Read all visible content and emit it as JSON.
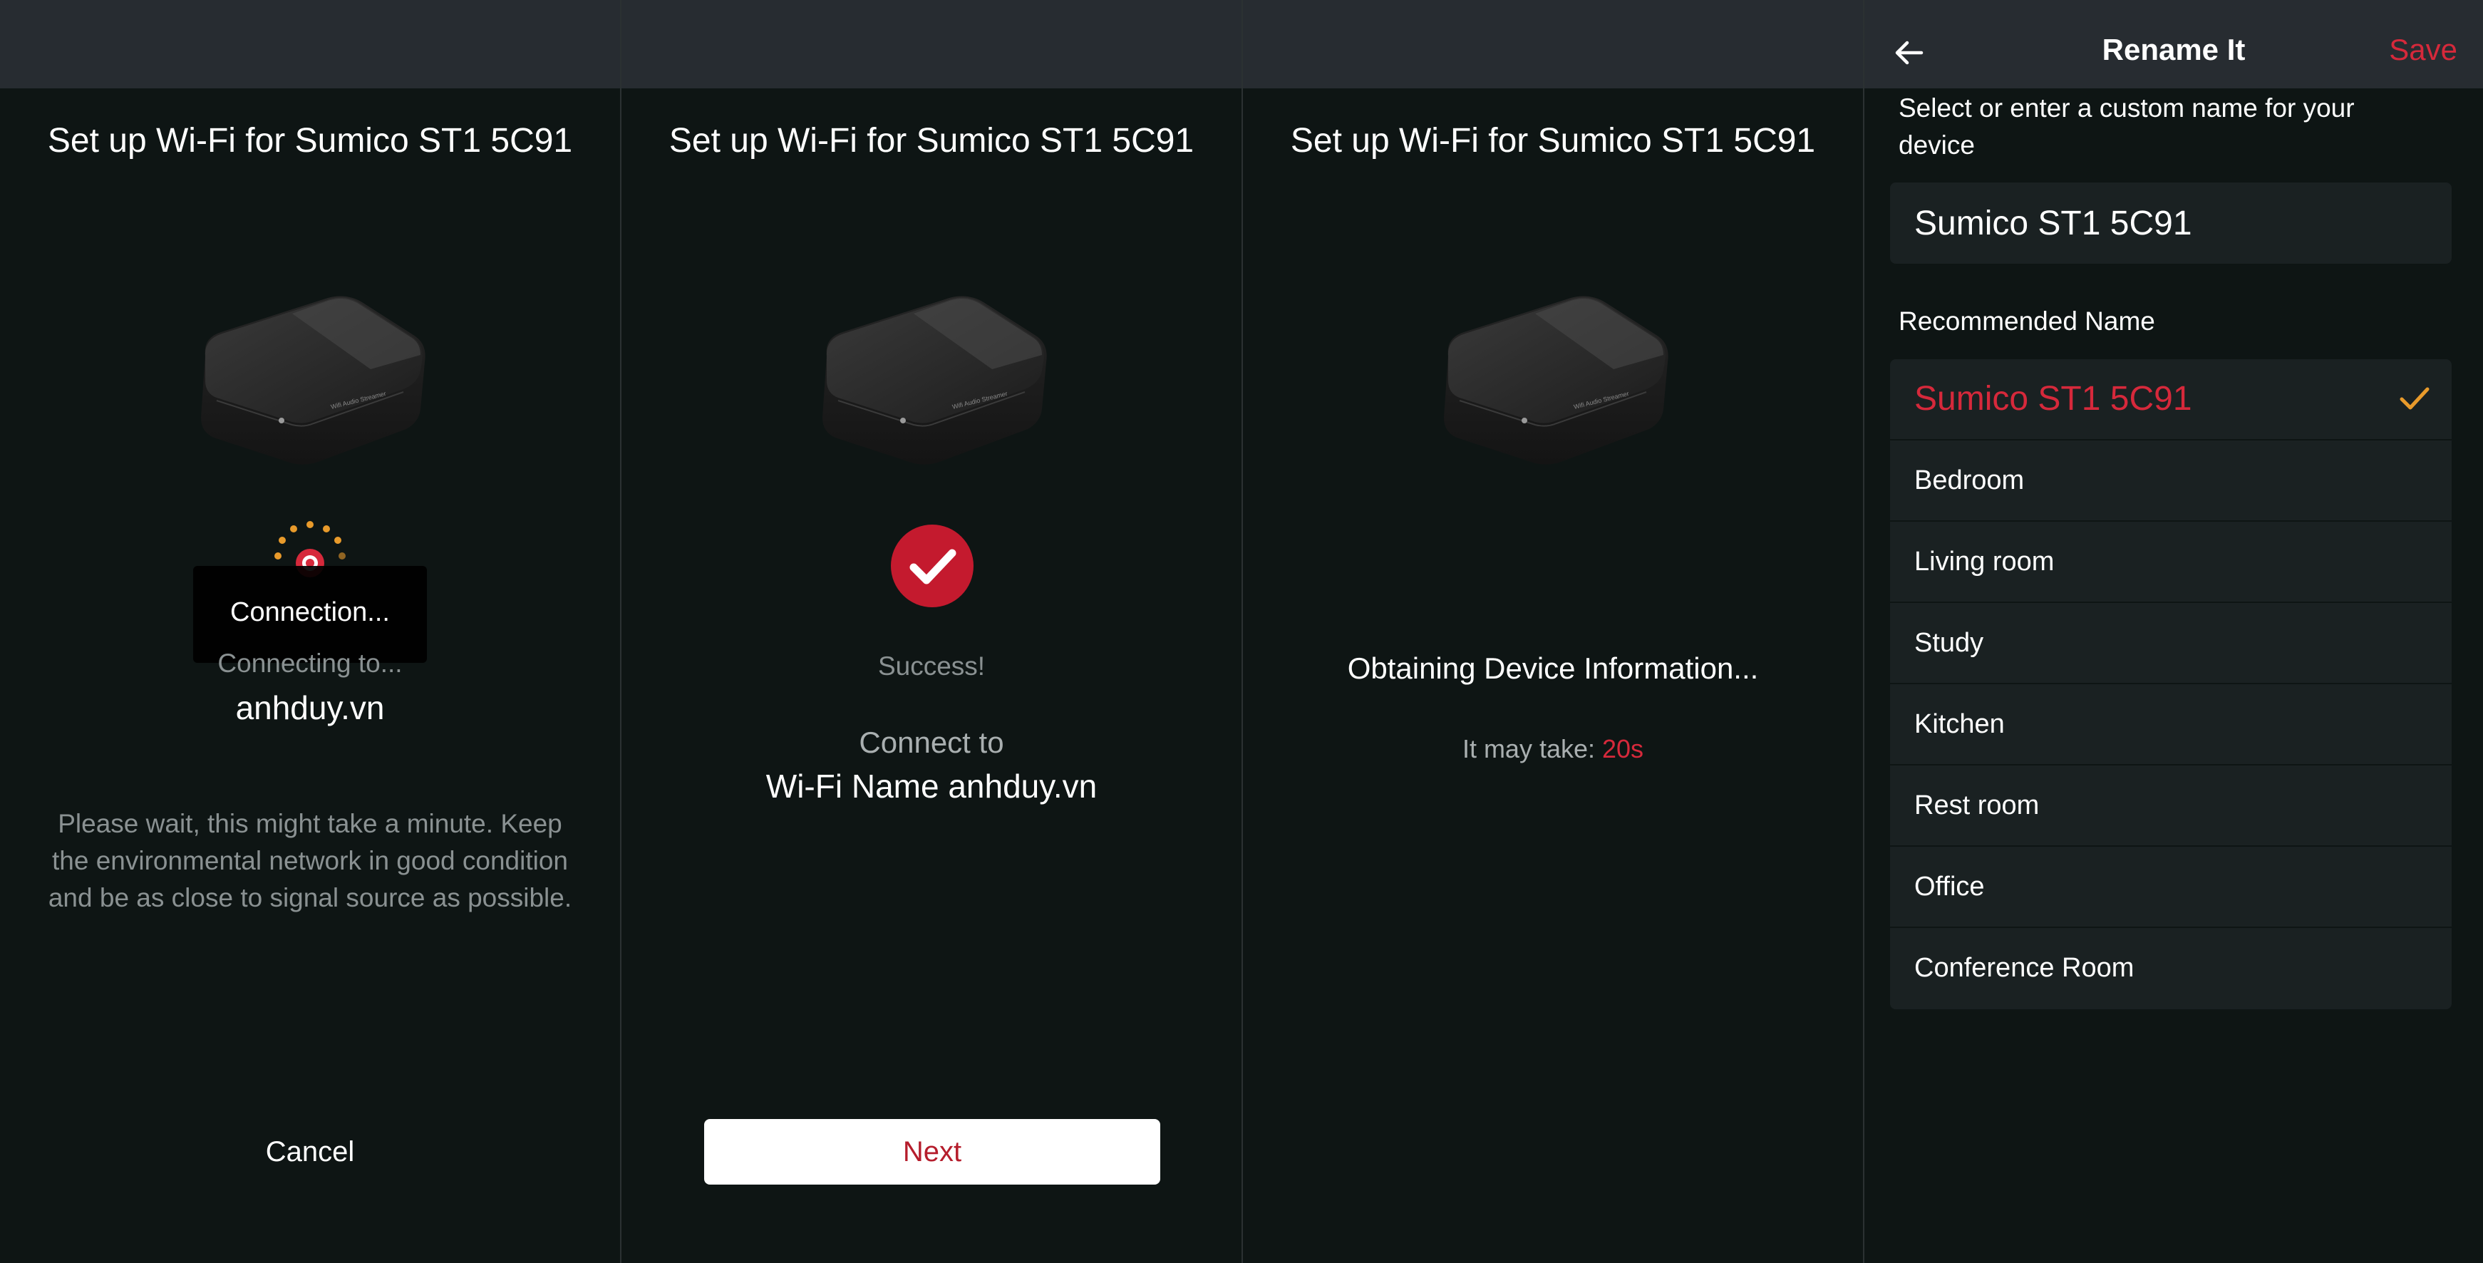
{
  "colors": {
    "accent_red": "#d6293b",
    "check_orange": "#e89a2b",
    "background": "#0e1514",
    "statusbar": "#272c31",
    "row_background": "#1a2122"
  },
  "screen_1": {
    "title": "Set up Wi-Fi for Sumico ST1 5C91",
    "device_image": "wifi-audio-streamer",
    "spinner_icon": "loading-spinner-icon",
    "toast": "Connection...",
    "connecting_to": "Connecting to...",
    "ssid": "anhduy.vn",
    "wait_message": "Please wait, this might take a minute. Keep the environmental network in good condition and be as close to signal source as possible.",
    "cancel_label": "Cancel"
  },
  "screen_2": {
    "title": "Set up Wi-Fi for Sumico ST1 5C91",
    "device_image": "wifi-audio-streamer",
    "status_icon": "check-circle-icon",
    "success": "Success!",
    "connect_to": "Connect to",
    "wifi_name": "Wi-Fi Name anhduy.vn",
    "next_label": "Next"
  },
  "screen_3": {
    "title": "Set up Wi-Fi for Sumico ST1 5C91",
    "device_image": "wifi-audio-streamer",
    "status": "Obtaining Device Information...",
    "may_take_label": "It may take:",
    "may_take_value": "20s"
  },
  "screen_4": {
    "back_icon": "arrow-left-icon",
    "title": "Rename It",
    "save_label": "Save",
    "hint": "Select or enter a custom name for your device",
    "name_value": "Sumico ST1 5C91",
    "recommended_label": "Recommended Name",
    "names": [
      {
        "label": "Sumico ST1 5C91",
        "selected": true
      },
      {
        "label": "Bedroom",
        "selected": false
      },
      {
        "label": "Living room",
        "selected": false
      },
      {
        "label": "Study",
        "selected": false
      },
      {
        "label": "Kitchen",
        "selected": false
      },
      {
        "label": "Rest room",
        "selected": false
      },
      {
        "label": "Office",
        "selected": false
      },
      {
        "label": "Conference Room",
        "selected": false
      }
    ]
  }
}
